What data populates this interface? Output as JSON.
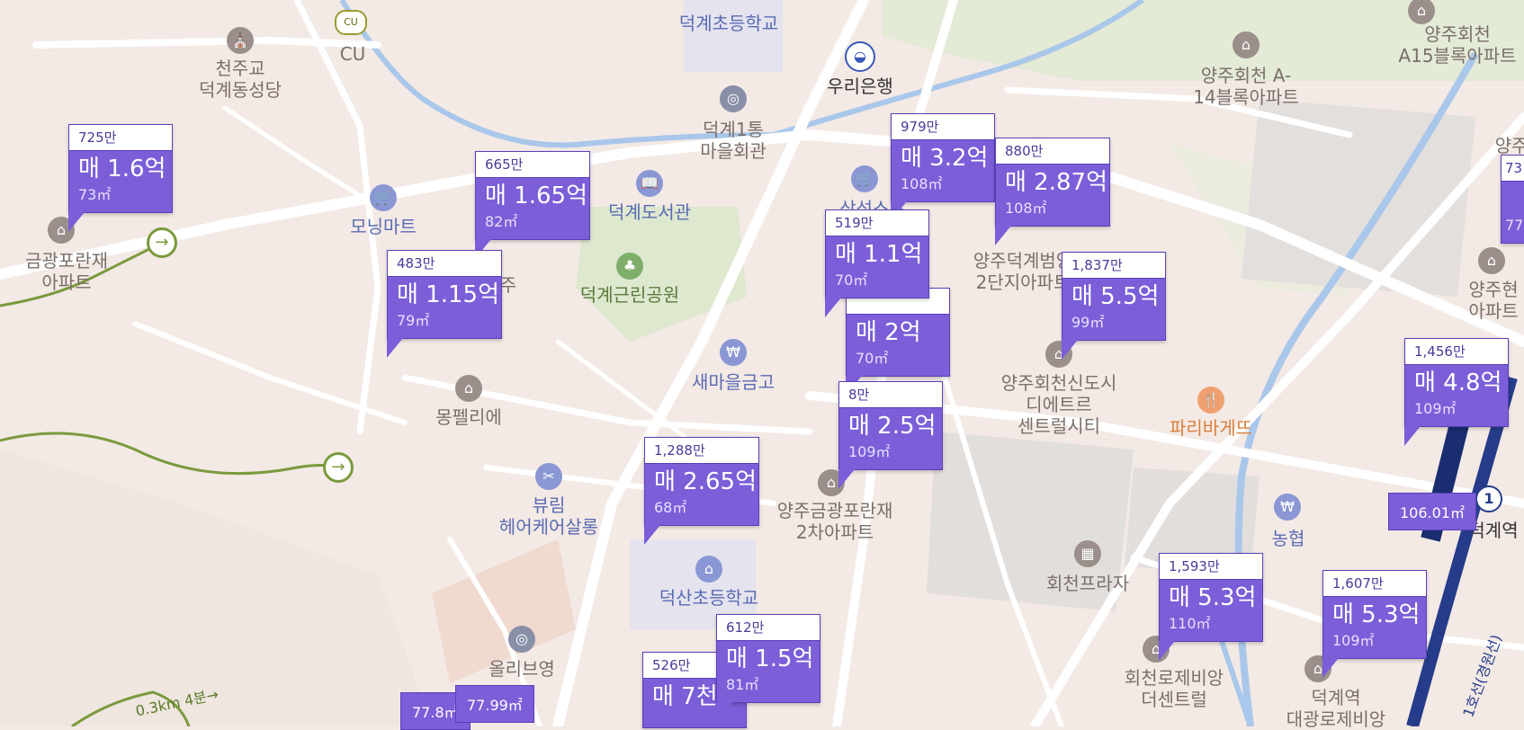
{
  "pois": {
    "cu_label": "CU",
    "cu_icon_text": "CU",
    "church": "천주교\n덕계동성당",
    "school_top": "덕계초등학교",
    "woori_bank": "우리은행",
    "community_center": "덕계1통\n마을회관",
    "library": "덕계도서관",
    "mart": "모닝마트",
    "park": "덕계근린공원",
    "samsung_partial": "삼성스토",
    "apt_geumgwang": "금광포란재\n아파트",
    "apt_yangju_a14": "양주회천 A-\n14블록아파트",
    "apt_yangju_a15": "양주회천\nA15블록아파트",
    "apt_deokgye_2": "양주덕계범양\n2단지아파트",
    "saemaeul": "새마을금고",
    "mongpelie": "몽펠리에",
    "apt_central": "양주회천신도시\n디에트르\n센트럴시티",
    "paris": "파리바게뜨",
    "yangju_hyeon": "양주현\n아파트",
    "yangju_top_right": "양주",
    "burim": "뷰림\n헤어케어살롱",
    "apt_geumgwang_2": "양주금광포란재\n2차아파트",
    "deoksan_school": "덕산초등학교",
    "nonghyup": "농협",
    "hoecheon_plaza": "회천프라자",
    "olive": "올리브영",
    "apt_rosebiang": "회천로제비앙\n더센트럴",
    "apt_deokgye_station": "덕계역\n대광로제비앙",
    "deokgye_station": "덕계역",
    "line1_label": "1호선(경원선)",
    "line1_badge": "1",
    "trail_note": "0.3km 4분→",
    "partial_ju": "주"
  },
  "listings": [
    {
      "id": "l1",
      "per_area": "725만",
      "price": "매 1.6억",
      "area": "73㎡"
    },
    {
      "id": "l2",
      "per_area": "665만",
      "price": "매 1.65억",
      "area": "82㎡"
    },
    {
      "id": "l3",
      "per_area": "483만",
      "price": "매 1.15억",
      "area": "79㎡"
    },
    {
      "id": "l4",
      "per_area": "979만",
      "price": "매 3.2억",
      "area": "108㎡"
    },
    {
      "id": "l5",
      "per_area": "880만",
      "price": "매 2.87억",
      "area": "108㎡"
    },
    {
      "id": "l6",
      "per_area": "519만",
      "price": "매 1.1억",
      "area": "70㎡"
    },
    {
      "id": "l7",
      "per_area": "",
      "price": "매 2억",
      "area": "70㎡"
    },
    {
      "id": "l8",
      "per_area": "1,837만",
      "price": "매 5.5억",
      "area": "99㎡"
    },
    {
      "id": "l9",
      "per_area": "8만",
      "price": "매 2.5억",
      "area": "109㎡"
    },
    {
      "id": "l10",
      "per_area": "1,456만",
      "price": "매 4.8억",
      "area": "109㎡"
    },
    {
      "id": "l11",
      "per_area": "1,288만",
      "price": "매 2.65억",
      "area": "68㎡"
    },
    {
      "id": "l12",
      "per_area": "1,593만",
      "price": "매 5.3억",
      "area": "110㎡"
    },
    {
      "id": "l13",
      "per_area": "1,607만",
      "price": "매 5.3억",
      "area": "109㎡"
    },
    {
      "id": "l14",
      "per_area": "612만",
      "price": "매 1.5억",
      "area": "81㎡"
    },
    {
      "id": "l15",
      "per_area": "526만",
      "price": "매 7천",
      "area": ""
    },
    {
      "id": "l16",
      "per_area": "73",
      "price": "",
      "area": "77"
    }
  ],
  "mini_listings": [
    "106.01㎡",
    "77.8㎡",
    "77.99㎡"
  ]
}
